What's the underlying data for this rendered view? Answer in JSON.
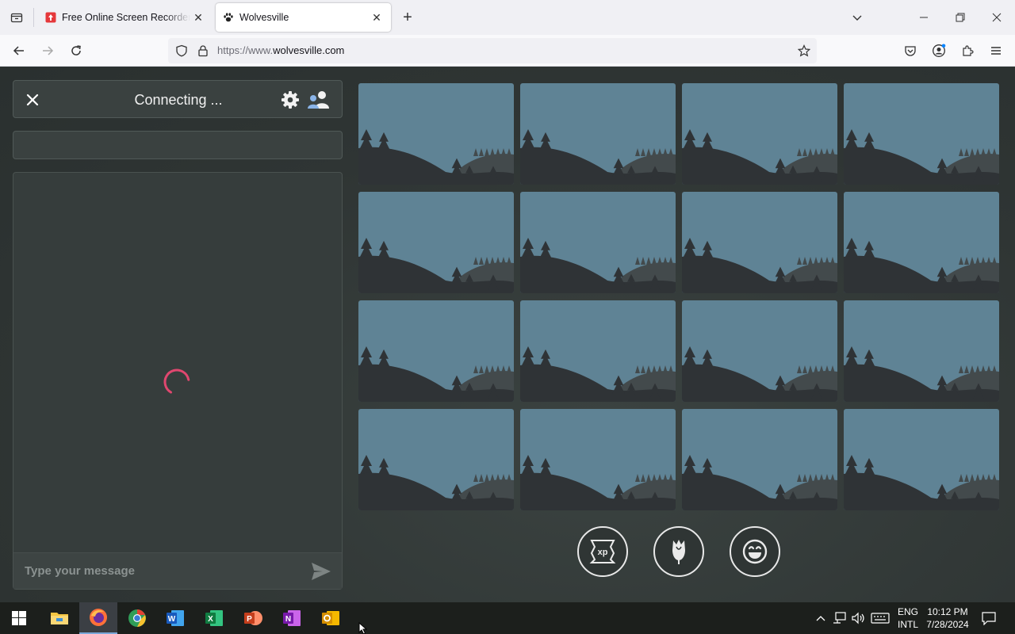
{
  "browser": {
    "tabs": [
      {
        "title": "Free Online Screen Recorder & Video Recorder",
        "active": false
      },
      {
        "title": "Wolvesville",
        "active": true
      }
    ],
    "url_prefix": "https://www.",
    "url_domain": "wolvesville.com"
  },
  "chat": {
    "status": "Connecting ...",
    "input_placeholder": "Type your message"
  },
  "player_grid": {
    "rows": 4,
    "columns": 4
  },
  "action_buttons": [
    "xp-boost-icon",
    "rose-icon",
    "emoji-icon"
  ],
  "taskbar": {
    "apps": [
      "file-explorer-icon",
      "firefox-icon",
      "chrome-icon",
      "word-icon",
      "excel-icon",
      "powerpoint-icon",
      "onenote-icon",
      "outlook-icon"
    ],
    "language": "ENG",
    "layout": "INTL",
    "time": "10:12 PM",
    "date": "7/28/2024"
  },
  "colors": {
    "sky": "#5f8395",
    "hill_dark": "#2f3336",
    "hill_mid": "#434a4c",
    "spinner": "#e0476f",
    "background": "#2e3433"
  }
}
